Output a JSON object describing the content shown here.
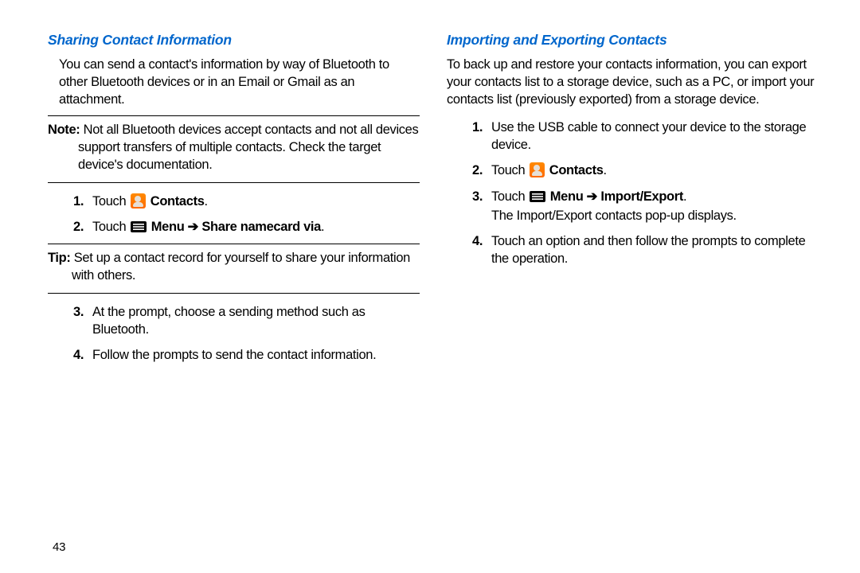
{
  "page_number": "43",
  "left": {
    "title": "Sharing Contact Information",
    "intro": "You can send a contact's information by way of Bluetooth to other Bluetooth devices or in an Email or Gmail as an attachment.",
    "note_label": "Note:",
    "note_body": " Not all Bluetooth devices accept contacts and not all devices support transfers of multiple contacts. Check the target device's documentation.",
    "step1_prefix": "Touch ",
    "step1_bold": " Contacts",
    "step1_suffix": ".",
    "step2_prefix": "Touch ",
    "step2_bold": " Menu ➔ Share namecard via",
    "step2_suffix": ".",
    "tip_label": "Tip:",
    "tip_body": " Set up a contact record for yourself to share your information with others.",
    "step3": "At the prompt, choose a sending method such as Bluetooth.",
    "step4": "Follow the prompts to send the contact information."
  },
  "right": {
    "title": "Importing and Exporting Contacts",
    "intro": "To back up and restore your contacts information, you can export your contacts list to a storage device, such as a PC, or import your contacts list (previously exported) from a storage device.",
    "step1": "Use the USB cable to connect your device to the storage device.",
    "step2_prefix": "Touch ",
    "step2_bold": " Contacts",
    "step2_suffix": ".",
    "step3_prefix": "Touch ",
    "step3_bold": " Menu ➔ Import/Export",
    "step3_suffix": ".",
    "step3_sub": "The Import/Export contacts pop-up displays.",
    "step4": "Touch an option and then follow the prompts to complete the operation."
  }
}
